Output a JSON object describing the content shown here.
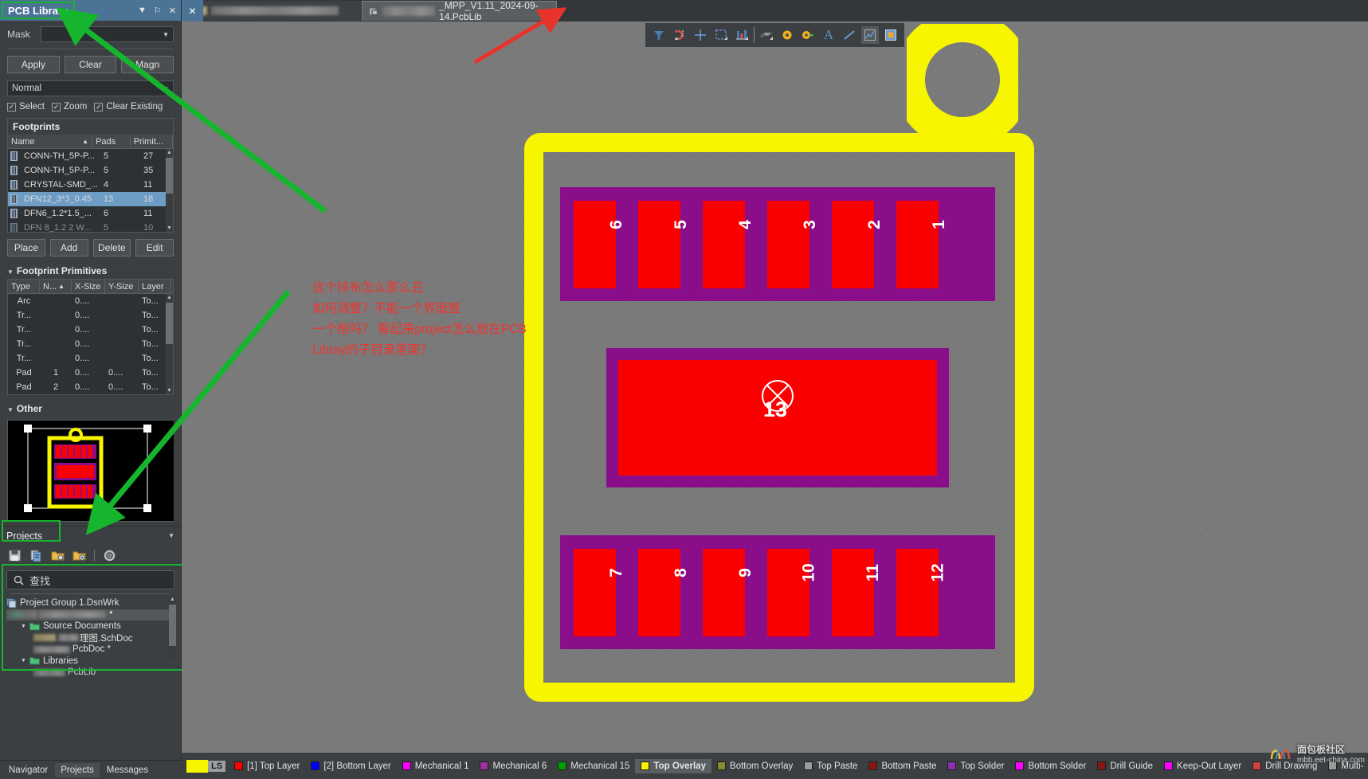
{
  "panel": {
    "title": "PCB Library",
    "controls": {
      "dropdown": "▼",
      "pin": "⚐",
      "close": "✕"
    },
    "mask_label": "Mask",
    "mask_value": "",
    "buttons": {
      "apply": "Apply",
      "clear": "Clear",
      "magnify": "Magn"
    },
    "mode_value": "Normal",
    "checks": [
      {
        "label": "Select",
        "checked": true
      },
      {
        "label": "Zoom",
        "checked": true
      },
      {
        "label": "Clear Existing",
        "checked": true
      }
    ],
    "footprints_section": "Footprints",
    "footprints_columns": [
      "Name",
      "Pads",
      "Primit..."
    ],
    "footprints_sort_col": "Name",
    "footprints_rows": [
      {
        "name": "CONN-TH_5P-P...",
        "pads": "5",
        "prim": "27",
        "selected": false
      },
      {
        "name": "CONN-TH_5P-P...",
        "pads": "5",
        "prim": "35",
        "selected": false
      },
      {
        "name": "CRYSTAL-SMD_...",
        "pads": "4",
        "prim": "11",
        "selected": false
      },
      {
        "name": "DFN12_3*3_0.45",
        "pads": "13",
        "prim": "18",
        "selected": true
      },
      {
        "name": "DFN6_1.2*1.5_...",
        "pads": "6",
        "prim": "11",
        "selected": false
      },
      {
        "name": "DFN 8_1.2 2 W...",
        "pads": "5",
        "prim": "10",
        "selected": false
      }
    ],
    "action_buttons": [
      "Place",
      "Add",
      "Delete",
      "Edit"
    ],
    "primitives_section": "Footprint Primitives",
    "primitives_columns": [
      "Type",
      "N...",
      "X-Size",
      "Y-Size",
      "Layer"
    ],
    "primitives_sort_col": "N...",
    "primitives_rows": [
      {
        "type": "Arc",
        "n": "",
        "x": "0....",
        "y": "",
        "layer": "To..."
      },
      {
        "type": "Tr...",
        "n": "",
        "x": "0....",
        "y": "",
        "layer": "To..."
      },
      {
        "type": "Tr...",
        "n": "",
        "x": "0....",
        "y": "",
        "layer": "To..."
      },
      {
        "type": "Tr...",
        "n": "",
        "x": "0....",
        "y": "",
        "layer": "To..."
      },
      {
        "type": "Tr...",
        "n": "",
        "x": "0....",
        "y": "",
        "layer": "To..."
      },
      {
        "type": "Pad",
        "n": "1",
        "x": "0....",
        "y": "0....",
        "layer": "To..."
      },
      {
        "type": "Pad",
        "n": "2",
        "x": "0....",
        "y": "0....",
        "layer": "To..."
      }
    ],
    "other_section": "Other"
  },
  "projects": {
    "title": "Projects",
    "dropdown_arrow": "▼",
    "toolbar_icons": [
      "save-icon",
      "copy-icon",
      "open-folder-search-icon",
      "open-folder-gear-icon",
      "settings-gear-icon"
    ],
    "search_placeholder": "查找",
    "search_value": "查找",
    "tree": [
      {
        "label": "Project Group 1.DsnWrk",
        "icon": "project-group-icon",
        "indent": 0,
        "blurred": false
      },
      {
        "label": "",
        "icon": "",
        "indent": 1,
        "blurred": true,
        "suffix": "*"
      },
      {
        "label": "Source Documents",
        "icon": "folder-icon",
        "indent": 2,
        "blurred": false,
        "expander": "◢"
      },
      {
        "label": "理图.SchDoc",
        "icon": "sch-icon",
        "indent": 3,
        "blurred": true
      },
      {
        "label": "PcbDoc *",
        "icon": "pcb-icon",
        "indent": 3,
        "blurred": true
      },
      {
        "label": "Libraries",
        "icon": "folder-icon",
        "indent": 2,
        "blurred": false,
        "expander": "◢"
      },
      {
        "label": "PcbLib",
        "icon": "pcblib-icon",
        "indent": 3,
        "blurred": true
      }
    ],
    "bottom_tabs": [
      "Navigator",
      "Projects",
      "Messages"
    ]
  },
  "tabs": {
    "close_glyph": "✕",
    "items": [
      {
        "label": "",
        "active": false,
        "blurred": true
      },
      {
        "label": "_MPP_V1.11_2024-09-14.PcbLib",
        "active": true,
        "blurred": true,
        "icon": "pcblib-doc-icon"
      }
    ]
  },
  "toolbar": {
    "items": [
      {
        "name": "filter-icon",
        "glyph": "▼"
      },
      {
        "name": "magnet-icon",
        "glyph": ""
      },
      {
        "name": "crosshair-icon",
        "glyph": "+"
      },
      {
        "name": "selection-rect-icon",
        "glyph": ""
      },
      {
        "name": "layer-stack-icon",
        "glyph": ""
      },
      {
        "name": "component-icon",
        "glyph": ""
      },
      {
        "name": "via-icon",
        "glyph": ""
      },
      {
        "name": "pad-icon",
        "glyph": ""
      },
      {
        "name": "text-icon",
        "glyph": "A"
      },
      {
        "name": "line-icon",
        "glyph": ""
      },
      {
        "name": "dimension-icon",
        "glyph": ""
      },
      {
        "name": "polygon-icon",
        "glyph": ""
      }
    ]
  },
  "board": {
    "pads_top": [
      "6",
      "5",
      "4",
      "3",
      "2",
      "1"
    ],
    "pads_bottom": [
      "7",
      "8",
      "9",
      "10",
      "11",
      "12"
    ],
    "center_pad": "13",
    "center_marker": "origin-cross-circle",
    "colors": {
      "outline": "#f8f500",
      "pad_fill": "#fb0000",
      "solder_mask": "#8a0e8a",
      "canvas": "#7a7a7a"
    }
  },
  "annotation": {
    "lines": [
      "这个排布怎么那么丑",
      "如何调整？不能一个界面整",
      "一个框吗？ 看起来project怎么放在PCB",
      "Libray的子目录里面？"
    ],
    "color": "#f0342e",
    "arrow_red_color": "#e8332a",
    "arrow_green_color": "#15b52e"
  },
  "status": {
    "ls_button": "LS",
    "ls_color": "#f8f500",
    "layers": [
      {
        "label": "[1] Top Layer",
        "color": "#ff0000",
        "active": false
      },
      {
        "label": "[2] Bottom Layer",
        "color": "#0000ff",
        "active": false
      },
      {
        "label": "Mechanical 1",
        "color": "#ff00ff",
        "active": false
      },
      {
        "label": "Mechanical 6",
        "color": "#a030a0",
        "active": false
      },
      {
        "label": "Mechanical 15",
        "color": "#00a000",
        "active": false
      },
      {
        "label": "Top Overlay",
        "color": "#f8f500",
        "active": true
      },
      {
        "label": "Bottom Overlay",
        "color": "#8a8a30",
        "active": false
      },
      {
        "label": "Top Paste",
        "color": "#9a9a9a",
        "active": false
      },
      {
        "label": "Bottom Paste",
        "color": "#8a1515",
        "active": false
      },
      {
        "label": "Top Solder",
        "color": "#8a30b0",
        "active": false
      },
      {
        "label": "Bottom Solder",
        "color": "#ff00ff",
        "active": false
      },
      {
        "label": "Drill Guide",
        "color": "#8a1515",
        "active": false
      },
      {
        "label": "Keep-Out Layer",
        "color": "#ff00ff",
        "active": false
      },
      {
        "label": "Drill Drawing",
        "color": "#d04040",
        "active": false
      },
      {
        "label": "Multi-",
        "color": "#9a9a9a",
        "active": false
      }
    ]
  },
  "watermark": {
    "text": "面包板社区",
    "sub": "mbb.eet-china.com"
  }
}
